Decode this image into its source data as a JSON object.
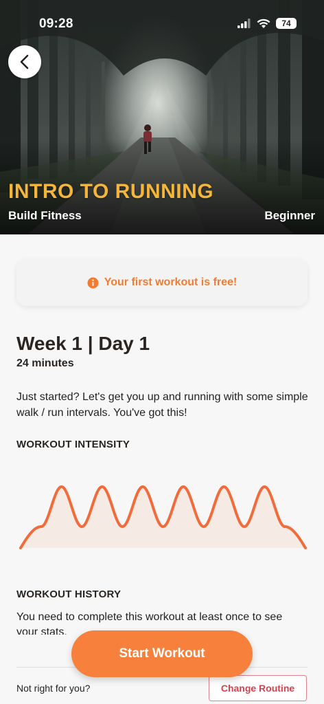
{
  "status_bar": {
    "time": "09:28",
    "battery": "74"
  },
  "hero": {
    "title": "INTRO TO RUNNING",
    "subtitle": "Build Fitness",
    "level": "Beginner"
  },
  "banner": {
    "text": "Your first workout is free!",
    "icon": "info-icon",
    "color": "#f07b31"
  },
  "workout": {
    "title": "Week 1 | Day 1",
    "duration": "24 minutes",
    "description": "Just started? Let's get you up and running with some simple walk / run intervals. You've got this!"
  },
  "intensity": {
    "label": "WORKOUT INTENSITY",
    "color": "#f26b3a",
    "run_intervals": 6
  },
  "history": {
    "label": "WORKOUT HISTORY",
    "text": "You need to complete this workout at least once to see your stats."
  },
  "footer": {
    "start_label": "Start Workout",
    "prompt": "Not right for you?",
    "change_label": "Change Routine"
  },
  "colors": {
    "accent": "#f6803c",
    "title_gold": "#f3b63b",
    "danger": "#d8404d"
  }
}
